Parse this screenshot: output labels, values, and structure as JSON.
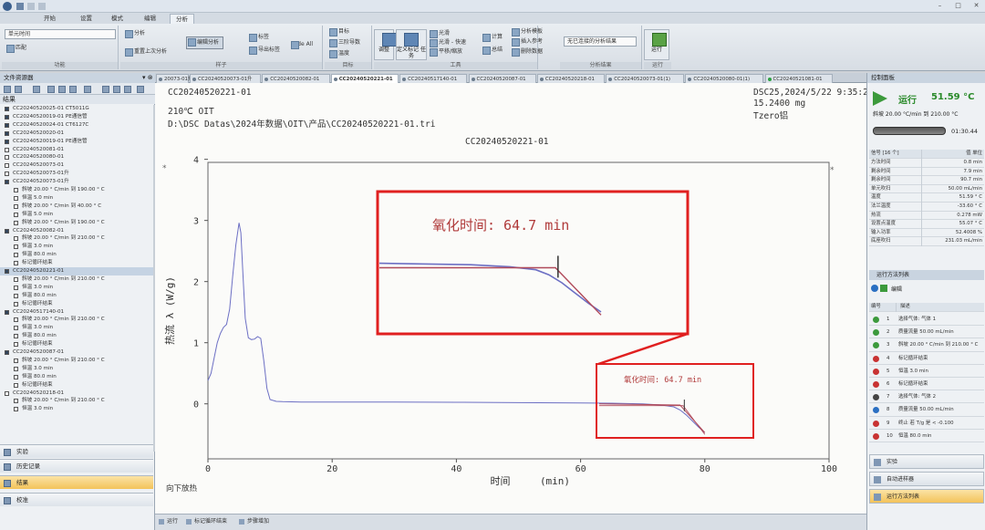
{
  "ribbon": {
    "tabs": [
      "开始",
      "设置",
      "模式",
      "编辑",
      "分析"
    ],
    "active_tab": "分析",
    "select_value": "单元时间",
    "select_button": "匹配",
    "group_labels": [
      "功能",
      "样子",
      "目标",
      "工具",
      "分析结果",
      "运行"
    ],
    "buttons": {
      "analyze": "分析",
      "prev_analysis": "重置上次分析",
      "edit_analysis": "编辑分析",
      "tags": "标签",
      "export_tags": "导出标签",
      "hide_all": "Hide All",
      "target1": "目标",
      "target2": "三阶导数",
      "target3": "温度",
      "adjust": "调整",
      "define_step": "定义标记\n任务",
      "tool1": "光滑",
      "tool2": "光滑 - 快速",
      "tool3": "平移/缩放",
      "calc": "计算",
      "sum": "总结",
      "save_model": "分析模板",
      "insert_ref": "插入参考",
      "clear": "删除数据",
      "result_select": "无已连接的分析结果",
      "run": "运行"
    }
  },
  "left_panel": {
    "title": "文件资源器",
    "results_header": "结果",
    "tree": [
      {
        "indent": 1,
        "icon": "fold",
        "text": "CC20240520025-01 CT5011G"
      },
      {
        "indent": 1,
        "icon": "fold",
        "text": "CC20240520019-01 PE通信管"
      },
      {
        "indent": 1,
        "icon": "fold",
        "text": "CC20240520024-01 CT6127C"
      },
      {
        "indent": 1,
        "icon": "fold",
        "text": "CC20240520020-01"
      },
      {
        "indent": 1,
        "icon": "fold",
        "text": "CC20240520019-01 PE通信管"
      },
      {
        "indent": 1,
        "icon": "file",
        "text": "CC20240520081-01"
      },
      {
        "indent": 1,
        "icon": "file",
        "text": "CC20240520080-01"
      },
      {
        "indent": 1,
        "icon": "file",
        "text": "CC20240520073-01"
      },
      {
        "indent": 1,
        "icon": "file",
        "text": "CC20240520073-01升"
      },
      {
        "indent": 1,
        "icon": "fold",
        "text": "CC20240520073-01升"
      },
      {
        "indent": 3,
        "icon": "file",
        "text": "斜坡 20.00 ° C/min 到 190.00 ° C"
      },
      {
        "indent": 3,
        "icon": "file",
        "text": "恒温 5.0 min"
      },
      {
        "indent": 3,
        "icon": "file",
        "text": "斜坡 20.00 ° C/min 到 40.00 ° C"
      },
      {
        "indent": 3,
        "icon": "file",
        "text": "恒温 5.0 min"
      },
      {
        "indent": 3,
        "icon": "file",
        "text": "斜坡 20.00 ° C/min 到 190.00 ° C"
      },
      {
        "indent": 1,
        "icon": "fold",
        "text": "CC20240520082-01"
      },
      {
        "indent": 3,
        "icon": "file",
        "text": "斜坡 20.00 ° C/min 到 210.00 ° C"
      },
      {
        "indent": 3,
        "icon": "file",
        "text": "恒温 3.0 min"
      },
      {
        "indent": 3,
        "icon": "file",
        "text": "恒温 80.0 min"
      },
      {
        "indent": 3,
        "icon": "file",
        "text": "标记循环结束"
      },
      {
        "indent": 1,
        "icon": "fold",
        "text": "CC20240520221-01",
        "selected": true
      },
      {
        "indent": 3,
        "icon": "file",
        "text": "斜坡 20.00 ° C/min 到 210.00 ° C"
      },
      {
        "indent": 3,
        "icon": "file",
        "text": "恒温 3.0 min"
      },
      {
        "indent": 3,
        "icon": "file",
        "text": "恒温 80.0 min"
      },
      {
        "indent": 3,
        "icon": "file",
        "text": "标记循环结束"
      },
      {
        "indent": 1,
        "icon": "fold",
        "text": "CC20240517140-01"
      },
      {
        "indent": 3,
        "icon": "file",
        "text": "斜坡 20.00 ° C/min 到 210.00 ° C"
      },
      {
        "indent": 3,
        "icon": "file",
        "text": "恒温 3.0 min"
      },
      {
        "indent": 3,
        "icon": "file",
        "text": "恒温 80.0 min"
      },
      {
        "indent": 3,
        "icon": "file",
        "text": "标记循环结束"
      },
      {
        "indent": 1,
        "icon": "fold",
        "text": "CC20240520087-01"
      },
      {
        "indent": 3,
        "icon": "file",
        "text": "斜坡 20.00 ° C/min 到 210.00 ° C"
      },
      {
        "indent": 3,
        "icon": "file",
        "text": "恒温 3.0 min"
      },
      {
        "indent": 3,
        "icon": "file",
        "text": "恒温 80.0 min"
      },
      {
        "indent": 3,
        "icon": "file",
        "text": "标记循环结束"
      },
      {
        "indent": 1,
        "icon": "file",
        "text": "CC20240520218-01"
      },
      {
        "indent": 3,
        "icon": "file",
        "text": "斜坡 20.00 ° C/min 到 210.00 ° C"
      },
      {
        "indent": 3,
        "icon": "file",
        "text": "恒温 3.0 min"
      }
    ],
    "nav": [
      "实验",
      "历史记录",
      "结果",
      "校准"
    ],
    "active_nav": "结果"
  },
  "doc_tabs": [
    {
      "label": "20073-01升"
    },
    {
      "label": "CC20240520073-01升"
    },
    {
      "label": "CC20240520082-01"
    },
    {
      "label": "CC20240520221-01",
      "active": true
    },
    {
      "label": "CC20240517140-01"
    },
    {
      "label": "CC20240520087-01"
    },
    {
      "label": "CC20240520218-01"
    },
    {
      "label": "CC20240520073-01(1)"
    },
    {
      "label": "CC20240520080-01(1)"
    },
    {
      "label": "CC20240521081-01",
      "green": true
    }
  ],
  "document": {
    "sample_name": "CC20240520221-01",
    "method": "210℃ OIT",
    "path": "D:\\DSC Datas\\2024年数据\\OIT\\产品\\CC20240520221-01.tri",
    "instrument_date": "DSC25,2024/5/22 9:35:24",
    "mass": "15.2400 mg",
    "mode": "Tzero铝",
    "exo_label": "向下放热"
  },
  "chart_data": {
    "type": "line",
    "title": "CC20240520221-01",
    "xlabel": "时间",
    "xunit": "(min)",
    "ylabel": "热流 λ (W/g)",
    "xlim": [
      0,
      100
    ],
    "ylim": [
      -0.9,
      3.95
    ],
    "xticks": [
      0,
      20,
      40,
      60,
      80,
      100
    ],
    "yticks": [
      0,
      1,
      2,
      3,
      4
    ],
    "x": [
      0,
      0.5,
      1,
      1.5,
      2,
      2.5,
      3,
      3.5,
      4,
      4.5,
      5,
      5.3,
      5.6,
      6,
      6.5,
      7,
      7.5,
      8,
      8.5,
      9,
      9.5,
      10,
      11,
      12,
      15,
      20,
      30,
      40,
      50,
      60,
      65,
      70,
      73,
      75,
      76,
      77,
      78,
      79,
      80
    ],
    "series": [
      {
        "values": [
          0.38,
          0.5,
          0.75,
          1.0,
          1.15,
          1.25,
          1.3,
          1.55,
          2.1,
          2.6,
          2.96,
          2.8,
          2.2,
          1.4,
          1.08,
          1.05,
          1.06,
          1.1,
          1.07,
          0.7,
          0.25,
          0.07,
          0.04,
          0.035,
          0.03,
          0.03,
          0.03,
          0.025,
          0.02,
          0.015,
          0.01,
          0.0,
          -0.02,
          -0.05,
          -0.1,
          -0.18,
          -0.28,
          -0.38,
          -0.47
        ]
      }
    ],
    "baseline": {
      "x": [
        63,
        76,
        80
      ],
      "y": [
        0.0,
        -0.02,
        -0.47
      ]
    },
    "extrapolated_onset_line": {
      "x": [
        63,
        76.5,
        80
      ],
      "y": [
        -0.03,
        -0.03,
        -0.5
      ]
    },
    "annotation": "氧化时间: 64.7 min",
    "inset_annotation": "氧化时间: 64.7 min",
    "grid": false
  },
  "right_panel": {
    "title": "控制面板",
    "status": "运行",
    "temperature": "51.59 °C",
    "segment": "斜坡 20.00 °C/min 到 210.00 °C",
    "elapsed": "01:30.44",
    "signal_header": [
      "信号 [16 个]",
      "值 单位"
    ],
    "signals": [
      {
        "name": "方法时间",
        "value": "0.8 min"
      },
      {
        "name": "剩余时间",
        "value": "7.9 min"
      },
      {
        "name": "剩余时间",
        "value": "90.7 min"
      },
      {
        "name": "单元吹扫",
        "value": "50.00 mL/min"
      },
      {
        "name": "温度",
        "value": "51.59 ° C"
      },
      {
        "name": "法兰温度",
        "value": "-33.60 ° C"
      },
      {
        "name": "热流",
        "value": "0.278 mW"
      },
      {
        "name": "设置点温度",
        "value": "55.07 ° C"
      },
      {
        "name": "输入功率",
        "value": "52.4008 %"
      },
      {
        "name": "底座吹扫",
        "value": "231.03 mL/min"
      }
    ],
    "method_title": "运行方法列表",
    "method_edit": "编辑",
    "method_header": [
      "编号",
      "描述"
    ],
    "method": [
      {
        "n": "1",
        "d": "选择气体: 气体 1",
        "c": "#3c9a3c"
      },
      {
        "n": "2",
        "d": "质量流量 50.00 mL/min",
        "c": "#3c9a3c"
      },
      {
        "n": "3",
        "d": "斜坡 20.00 ° C/min 到 210.00 ° C",
        "c": "#3c9a3c"
      },
      {
        "n": "4",
        "d": "标记循环结束",
        "c": "#c83232"
      },
      {
        "n": "5",
        "d": "恒温 3.0 min",
        "c": "#c83232"
      },
      {
        "n": "6",
        "d": "标记循环结束",
        "c": "#c83232"
      },
      {
        "n": "7",
        "d": "选择气体: 气体 2",
        "c": "#444444"
      },
      {
        "n": "8",
        "d": "质量流量 50.00 mL/min",
        "c": "#2a6fc2"
      },
      {
        "n": "9",
        "d": "终止 若 T/g 是 < -0.100",
        "c": "#c83232"
      },
      {
        "n": "10",
        "d": "恒温 80.0 min",
        "c": "#c83232"
      }
    ],
    "nav": [
      "实验",
      "自动进样器",
      "运行方法列表"
    ],
    "active_nav": "运行方法列表"
  },
  "statusbar": [
    "运行",
    "标记循环结束",
    "步骤增加"
  ],
  "colors": {
    "accent_green": "#2ea043",
    "curve_main": "#6c6fc4",
    "curve_baseline": "#b04a5a",
    "highlight_box": "#e02020",
    "ribbon_bg": "#dfe4ea"
  }
}
